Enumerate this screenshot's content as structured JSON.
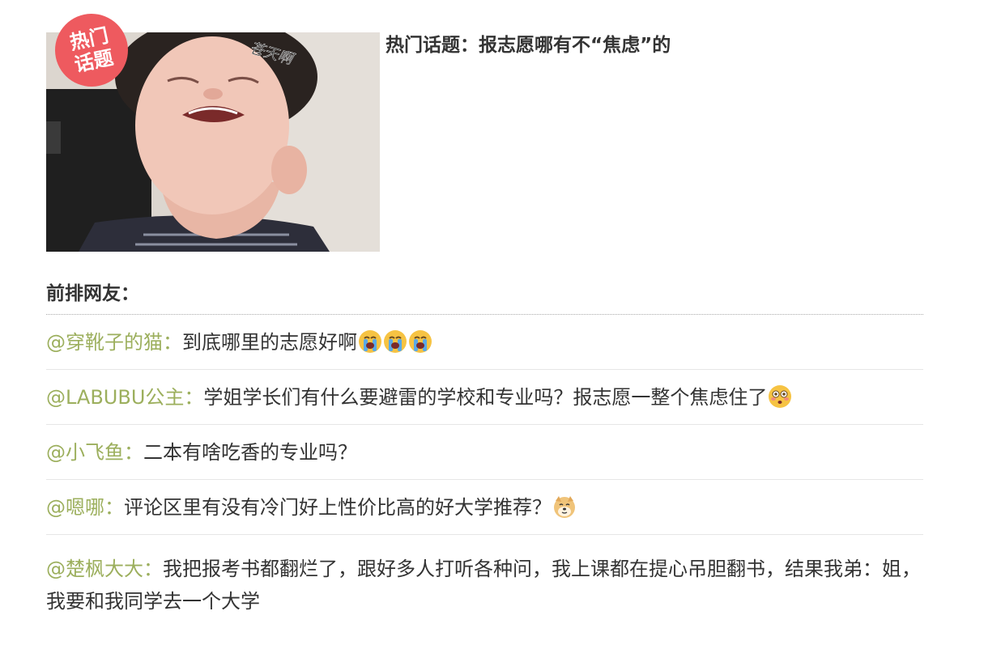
{
  "topic": {
    "badge_line1": "热门",
    "badge_line2": "话题",
    "image_caption": "苍天啊",
    "title": "热门话题：报志愿哪有不“焦虑”的"
  },
  "section": {
    "label": "前排网友："
  },
  "comments": [
    {
      "user": "@穿靴子的猫：",
      "text": "到底哪里的志愿好啊",
      "emojis": [
        "loudly-crying-face",
        "loudly-crying-face",
        "loudly-crying-face"
      ]
    },
    {
      "user": "@LABUBU公主：",
      "text": "学姐学长们有什么要避雷的学校和专业吗？报志愿一整个焦虑住了",
      "emojis": [
        "flushed-face"
      ]
    },
    {
      "user": "@小飞鱼：",
      "text": "二本有啥吃香的专业吗？",
      "emojis": []
    },
    {
      "user": "@嗯哪：",
      "text": "评论区里有没有冷门好上性价比高的好大学推荐？",
      "emojis": [
        "doge-face"
      ]
    },
    {
      "user": "@楚枫大大：",
      "text": "我把报考书都翻烂了，跟好多人打听各种问，我上课都在提心吊胆翻书，结果我弟：姐，我要和我同学去一个大学",
      "emojis": []
    }
  ],
  "colors": {
    "username": "#9caf5d",
    "badge": "#ee5a5f",
    "text": "#333333"
  }
}
